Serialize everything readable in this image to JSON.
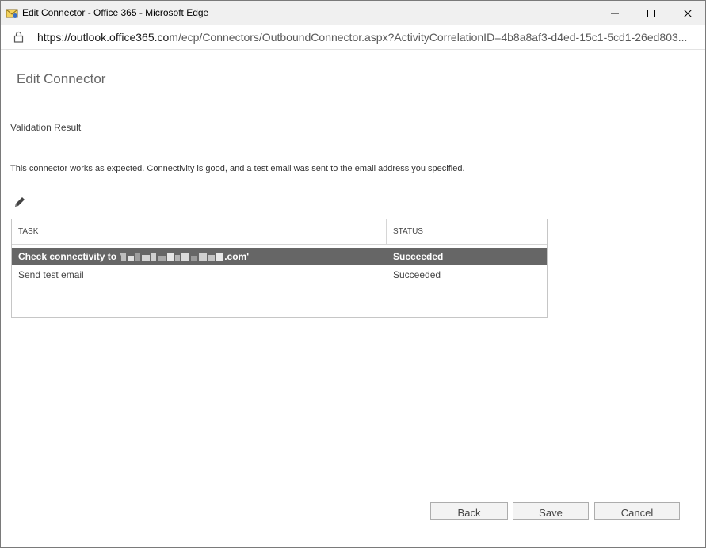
{
  "window": {
    "title": "Edit Connector - Office 365 - Microsoft Edge",
    "url_host": "https://outlook.office365.com",
    "url_path": "/ecp/Connectors/OutboundConnector.aspx?ActivityCorrelationID=4b8a8af3-d4ed-15c1-5cd1-26ed803..."
  },
  "page": {
    "title": "Edit Connector",
    "section_title": "Validation Result",
    "result_message": "This connector works as expected. Connectivity is good, and a test email was sent to the email address you specified."
  },
  "grid": {
    "columns": [
      "TASK",
      "STATUS"
    ],
    "rows": [
      {
        "task_prefix": "Check connectivity to '",
        "task_suffix": ".com'",
        "status": "Succeeded",
        "selected": true
      },
      {
        "task": "Send test email",
        "status": "Succeeded",
        "selected": false
      }
    ]
  },
  "buttons": {
    "back": "Back",
    "save": "Save",
    "cancel": "Cancel"
  },
  "icons": {
    "app": "envelope-icon",
    "lock": "lock-icon",
    "edit": "pencil-icon",
    "minimize": "minimize-icon",
    "maximize": "maximize-icon",
    "close": "close-icon"
  },
  "colors": {
    "selected_row": "#666666",
    "titlebar": "#f0f0f0",
    "button_bg": "#f3f3f3"
  }
}
